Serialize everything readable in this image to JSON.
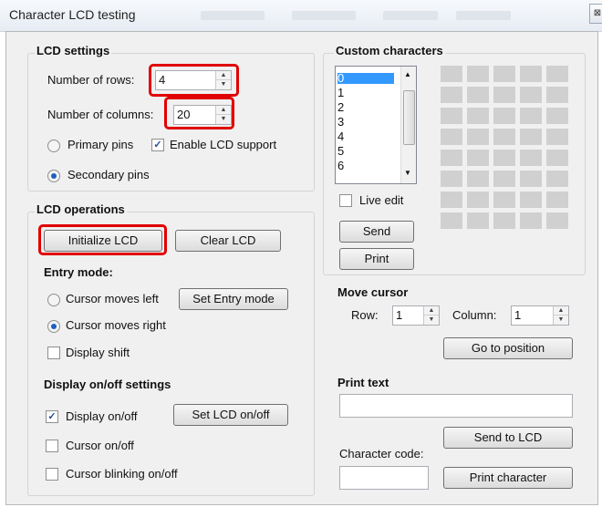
{
  "window": {
    "title": "Character LCD testing",
    "close_glyph": "⊠"
  },
  "lcd_settings": {
    "title": "LCD settings",
    "rows_label": "Number of rows:",
    "rows_value": "4",
    "columns_label": "Number of columns:",
    "columns_value": "20",
    "primary_pins": "Primary pins",
    "enable_lcd": "Enable LCD support",
    "secondary_pins": "Secondary pins"
  },
  "lcd_operations": {
    "title": "LCD operations",
    "initialize": "Initialize LCD",
    "clear": "Clear LCD",
    "entry_mode_title": "Entry mode:",
    "cursor_left": "Cursor moves left",
    "set_entry_mode": "Set Entry mode",
    "cursor_right": "Cursor moves right",
    "display_shift": "Display shift",
    "display_title": "Display on/off settings",
    "display_onoff": "Display on/off",
    "set_lcd_onoff": "Set LCD on/off",
    "cursor_onoff": "Cursor on/off",
    "cursor_blinking": "Cursor blinking on/off"
  },
  "custom_chars": {
    "title": "Custom characters",
    "items": [
      "0",
      "1",
      "2",
      "3",
      "4",
      "5",
      "6"
    ],
    "live_edit": "Live edit",
    "send": "Send",
    "print": "Print"
  },
  "move_cursor": {
    "title": "Move cursor",
    "row_label": "Row:",
    "row_value": "1",
    "column_label": "Column:",
    "column_value": "1",
    "go_button": "Go to position"
  },
  "print_text": {
    "title": "Print text",
    "text_value": "",
    "send_button": "Send to LCD",
    "char_code_label": "Character code:",
    "char_code_value": "",
    "print_char_button": "Print character"
  },
  "colors": {
    "highlight": "#e00000",
    "selection": "#3399ff",
    "pixel_off": "#d0d0d0"
  }
}
